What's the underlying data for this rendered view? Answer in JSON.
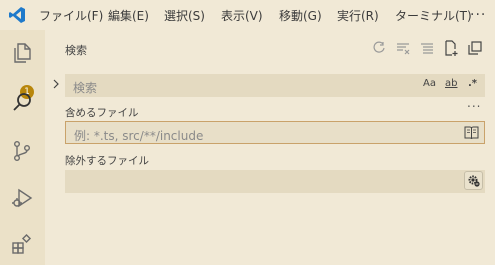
{
  "menu": {
    "items": [
      "ファイル(F)",
      "編集(E)",
      "選択(S)",
      "表示(V)",
      "移動(G)",
      "実行(R)",
      "ターミナル(T)"
    ],
    "more": "..."
  },
  "activity": {
    "explorer_badge": "1",
    "icons": [
      "files-icon",
      "search-icon",
      "source-control-icon",
      "run-debug-icon",
      "extensions-icon"
    ]
  },
  "search": {
    "title": "検索",
    "search_placeholder": "検索",
    "match_case": "Aa",
    "whole_word": "ab",
    "regex": ".*",
    "include_label": "含めるファイル",
    "include_placeholder": "例: *.ts, src/**/include",
    "exclude_label": "除外するファイル",
    "more_actions": "...",
    "toolbar_icons": [
      "refresh-icon",
      "clear-results-icon",
      "collapse-all-icon",
      "new-search-editor-icon",
      "view-as-tree-icon"
    ]
  },
  "colors": {
    "background": "#f1e9d6",
    "input": "#e4dac1",
    "focus_border": "#c9a26a",
    "badge": "#b8860b",
    "vscode_blue": "#1f7acb"
  }
}
